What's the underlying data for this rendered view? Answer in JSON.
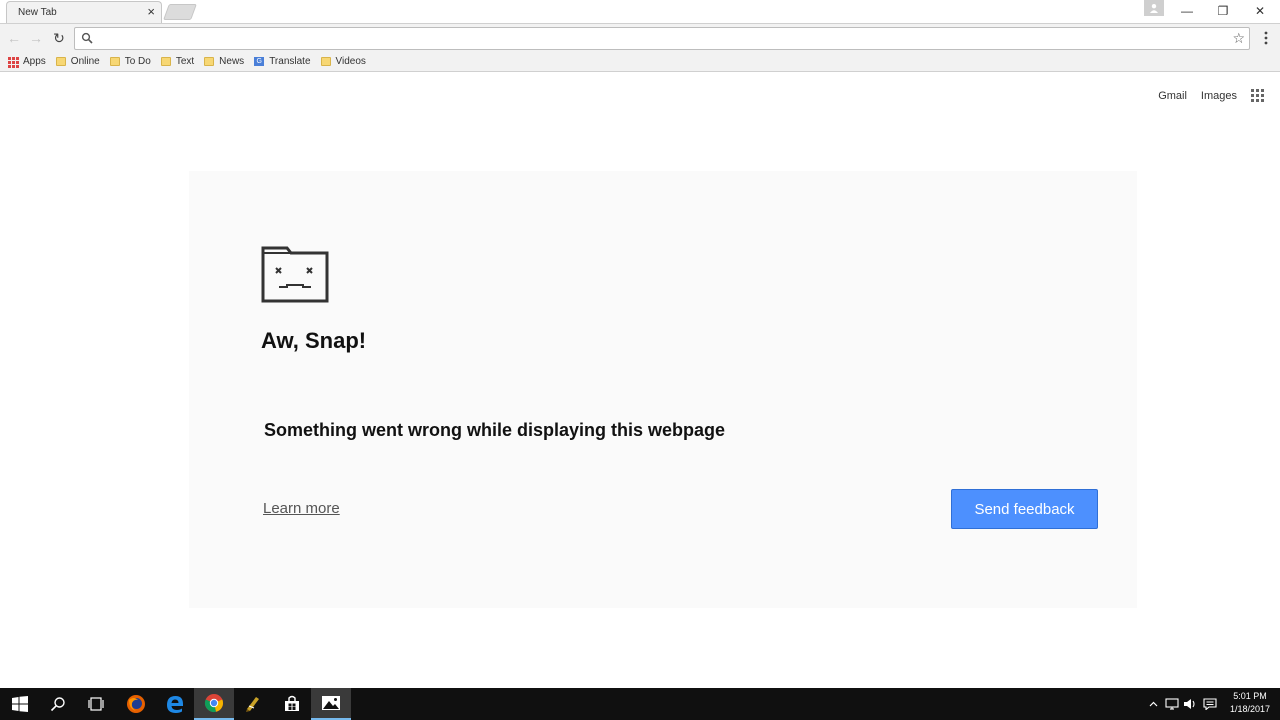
{
  "tab": {
    "title": "New Tab",
    "close": "×"
  },
  "window": {
    "minimize": "—",
    "restore": "❐",
    "close": "✕"
  },
  "toolbar": {
    "back": "←",
    "forward": "→",
    "reload": "↻",
    "omnibox_value": "",
    "star": "☆"
  },
  "bookmarks": {
    "items": [
      {
        "label": "Apps",
        "icon": "apps-icon"
      },
      {
        "label": "Online",
        "icon": "folder-icon"
      },
      {
        "label": "To Do",
        "icon": "folder-icon"
      },
      {
        "label": "Text",
        "icon": "folder-icon"
      },
      {
        "label": "News",
        "icon": "folder-icon"
      },
      {
        "label": "Translate",
        "icon": "translate-icon"
      },
      {
        "label": "Videos",
        "icon": "folder-icon"
      }
    ]
  },
  "page": {
    "links": {
      "gmail": "Gmail",
      "images": "Images"
    },
    "error": {
      "title": "Aw, Snap!",
      "message": "Something went wrong while displaying this webpage",
      "learn_more": "Learn more",
      "send_feedback": "Send feedback"
    }
  },
  "taskbar": {
    "time": "5:01 PM",
    "date": "1/18/2017",
    "apps": [
      "start-icon",
      "search-icon",
      "task-view-icon",
      "firefox-icon",
      "edge-icon",
      "chrome-icon",
      "winrar-icon",
      "store-icon",
      "photos-icon"
    ]
  },
  "colors": {
    "accent": "#4d90fe",
    "taskbar": "#101010",
    "folder": "#f7d774"
  }
}
